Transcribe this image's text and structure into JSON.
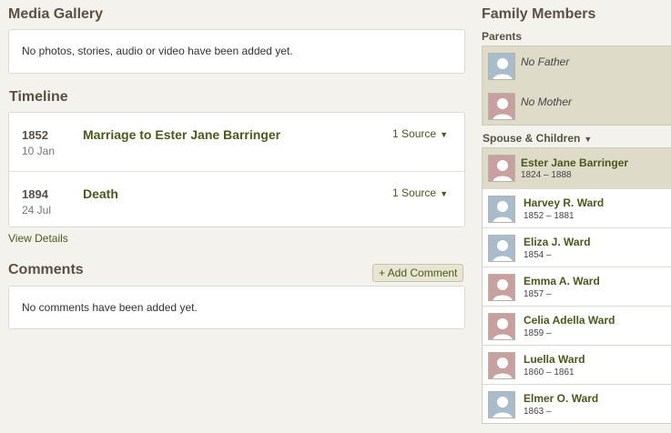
{
  "media": {
    "title": "Media Gallery",
    "empty": "No photos, stories, audio or video have been added yet."
  },
  "timeline": {
    "title": "Timeline",
    "events": [
      {
        "year": "1852",
        "day": "10 Jan",
        "event": "Marriage to Ester Jane Barringer",
        "source": "1 Source"
      },
      {
        "year": "1894",
        "day": "24 Jul",
        "event": "Death",
        "source": "1 Source"
      }
    ],
    "view_details": "View Details"
  },
  "comments": {
    "title": "Comments",
    "add_label": "+ Add Comment",
    "empty": "No comments have been added yet."
  },
  "family": {
    "title": "Family Members",
    "parents_label": "Parents",
    "parents": [
      {
        "name": "No Father",
        "gender": "male"
      },
      {
        "name": "No Mother",
        "gender": "female"
      }
    ],
    "spouse_children_label": "Spouse & Children",
    "spouse": {
      "name": "Ester Jane Barringer",
      "life": "1824 – 1888",
      "gender": "female"
    },
    "children": [
      {
        "name": "Harvey R. Ward",
        "life": "1852 – 1881",
        "gender": "male"
      },
      {
        "name": "Eliza J. Ward",
        "life": "1854 –",
        "gender": "male"
      },
      {
        "name": "Emma A. Ward",
        "life": "1857 –",
        "gender": "female"
      },
      {
        "name": "Celia Adella Ward",
        "life": "1859 –",
        "gender": "female"
      },
      {
        "name": "Luella Ward",
        "life": "1860 – 1861",
        "gender": "female"
      },
      {
        "name": "Elmer O. Ward",
        "life": "1863 –",
        "gender": "male"
      }
    ]
  },
  "icons": {
    "source_caret": "caret-down-icon",
    "avatar": "person-silhouette-icon"
  },
  "colors": {
    "link_green": "#4a5a1c",
    "heading_brown": "#5a5144",
    "male_avatar": "#a9bccb",
    "female_avatar": "#c8a0a0",
    "highlight": "#dedbc9"
  }
}
